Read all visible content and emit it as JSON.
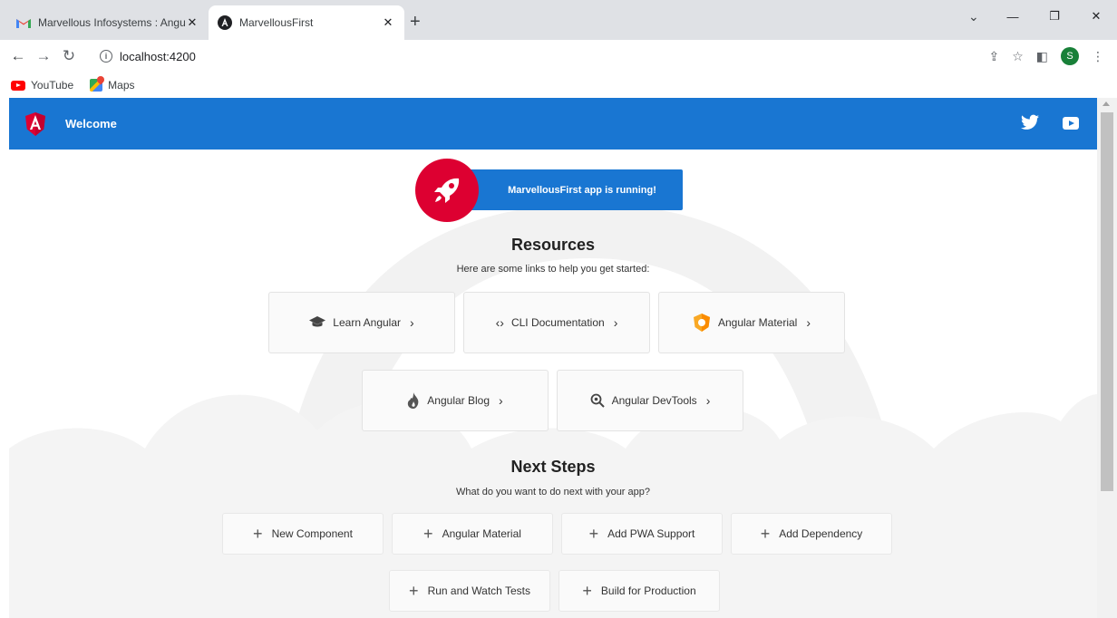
{
  "browser": {
    "tabs": [
      {
        "title": "Marvellous Infosystems : Angular",
        "icon": "gmail-icon"
      },
      {
        "title": "MarvellousFirst",
        "icon": "angular-icon"
      }
    ],
    "url": "localhost:4200",
    "profile_initial": "S",
    "bookmarks": [
      {
        "label": "YouTube",
        "icon": "youtube-icon"
      },
      {
        "label": "Maps",
        "icon": "maps-icon"
      }
    ]
  },
  "app": {
    "toolbar_title": "Welcome",
    "banner": "MarvellousFirst app is running!",
    "resources": {
      "heading": "Resources",
      "subtitle": "Here are some links to help you get started:",
      "cards": [
        {
          "label": "Learn Angular",
          "icon": "graduation-cap-icon"
        },
        {
          "label": "CLI Documentation",
          "icon": "code-brackets-icon"
        },
        {
          "label": "Angular Material",
          "icon": "angular-material-icon"
        },
        {
          "label": "Angular Blog",
          "icon": "flame-icon"
        },
        {
          "label": "Angular DevTools",
          "icon": "magnifier-icon"
        }
      ]
    },
    "next_steps": {
      "heading": "Next Steps",
      "subtitle": "What do you want to do next with your app?",
      "buttons": [
        {
          "label": "New Component"
        },
        {
          "label": "Angular Material"
        },
        {
          "label": "Add PWA Support"
        },
        {
          "label": "Add Dependency"
        },
        {
          "label": "Run and Watch Tests"
        },
        {
          "label": "Build for Production"
        }
      ]
    }
  },
  "colors": {
    "accent": "#1976d2",
    "angular_red": "#dd0031",
    "material_orange": "#f9a825"
  }
}
